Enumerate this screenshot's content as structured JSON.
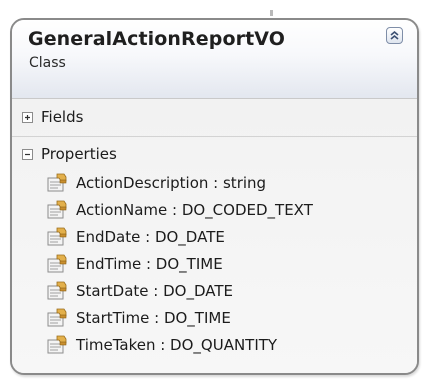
{
  "class": {
    "name": "GeneralActionReportVO",
    "stereotype": "Class",
    "collapse_icon": "double-chevron-up-icon"
  },
  "compartments": {
    "fields": {
      "label": "Fields",
      "state": "collapsed",
      "expander_icon": "plus-box-icon"
    },
    "properties": {
      "label": "Properties",
      "state": "expanded",
      "expander_icon": "minus-box-icon"
    }
  },
  "properties": [
    {
      "text": "ActionDescription : string",
      "icon": "property-icon"
    },
    {
      "text": "ActionName : DO_CODED_TEXT",
      "icon": "property-icon"
    },
    {
      "text": "EndDate : DO_DATE",
      "icon": "property-icon"
    },
    {
      "text": "EndTime : DO_TIME",
      "icon": "property-icon"
    },
    {
      "text": "StartDate : DO_DATE",
      "icon": "property-icon"
    },
    {
      "text": "StartTime : DO_TIME",
      "icon": "property-icon"
    },
    {
      "text": "TimeTaken : DO_QUANTITY",
      "icon": "property-icon"
    }
  ],
  "colors": {
    "border": "#8a8a8a",
    "header_gradient_end": "#e3e7ef",
    "body": "#f4f4f4"
  }
}
